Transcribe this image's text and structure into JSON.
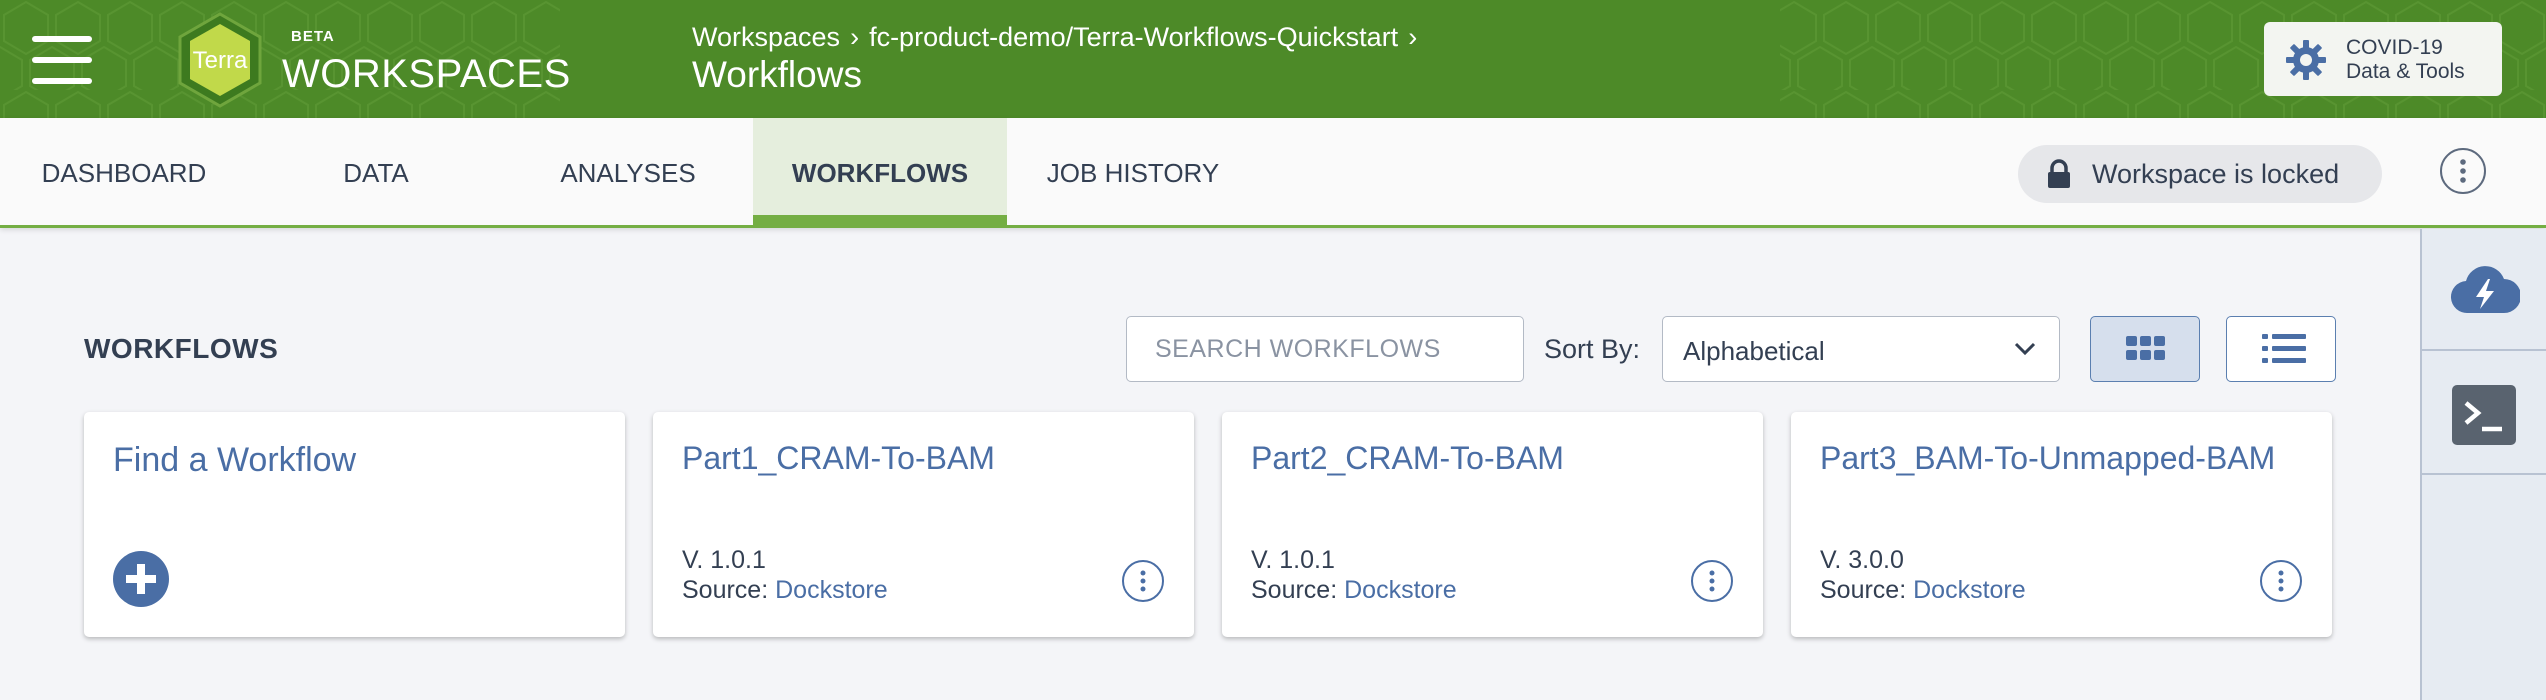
{
  "header": {
    "beta_label": "BETA",
    "brand_title": "WORKSPACES",
    "logo_text": "Terra",
    "breadcrumb": [
      "Workspaces",
      "fc-product-demo/Terra-Workflows-Quickstart"
    ],
    "breadcrumb_sep": "›",
    "page_title": "Workflows",
    "covid_button": {
      "line1": "COVID-19",
      "line2": "Data & Tools",
      "icon": "gear-icon"
    },
    "brand_color": "#4d8a28"
  },
  "tabs": {
    "items": [
      "DASHBOARD",
      "DATA",
      "ANALYSES",
      "WORKFLOWS",
      "JOB HISTORY"
    ],
    "active": "WORKFLOWS",
    "lock_status": "Workspace is locked",
    "accent_color": "#74ae43"
  },
  "workflows_panel": {
    "title": "WORKFLOWS",
    "search_placeholder": "SEARCH WORKFLOWS",
    "sort_label": "Sort By:",
    "sort_value": "Alphabetical",
    "view_mode": "grid"
  },
  "cards": {
    "find": {
      "title": "Find a Workflow",
      "icon": "plus-circle-icon"
    },
    "workflows": [
      {
        "name": "Part1_CRAM-To-BAM",
        "version": "V. 1.0.1",
        "source_label": "Source:",
        "source": "Dockstore"
      },
      {
        "name": "Part2_CRAM-To-BAM",
        "version": "V. 1.0.1",
        "source_label": "Source:",
        "source": "Dockstore"
      },
      {
        "name": "Part3_BAM-To-Unmapped-BAM",
        "version": "V. 3.0.0",
        "source_label": "Source:",
        "source": "Dockstore"
      }
    ]
  },
  "right_sidebar": {
    "icons": [
      "cloud-lightning-icon",
      "terminal-icon"
    ]
  }
}
